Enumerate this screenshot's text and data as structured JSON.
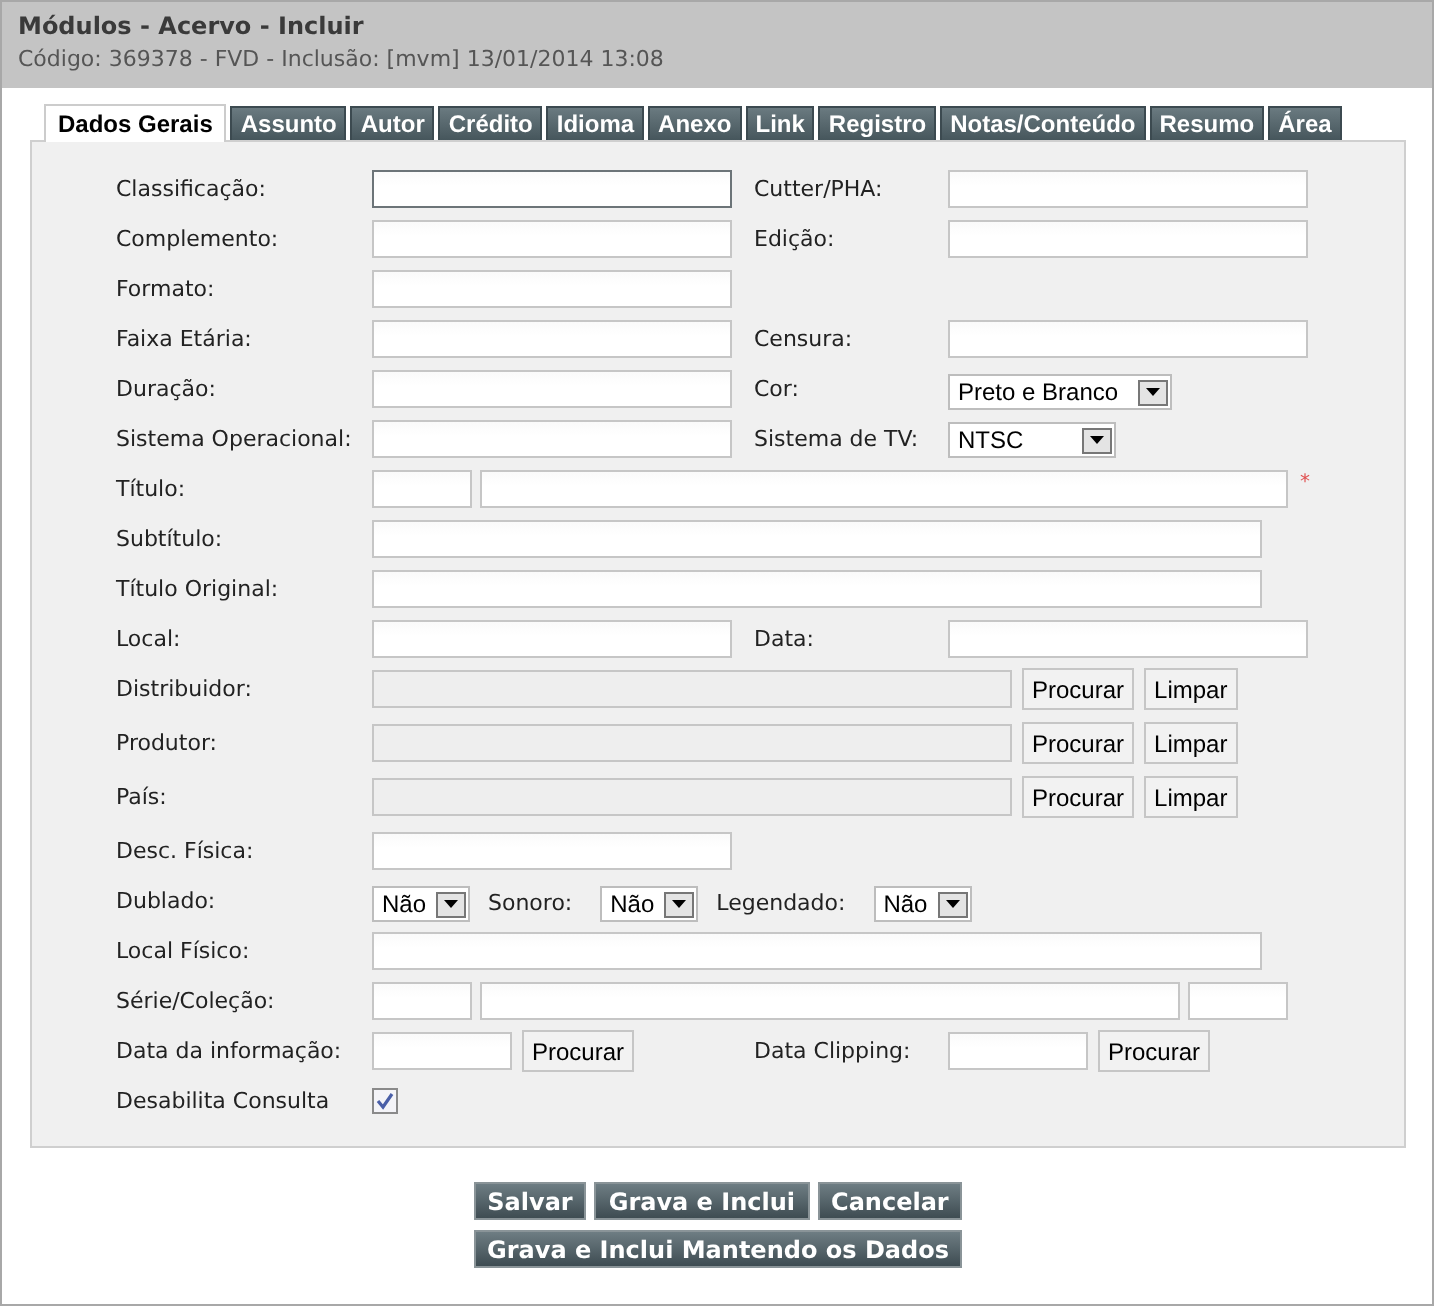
{
  "header": {
    "title": "Módulos - Acervo - Incluir",
    "subtitle": "Código: 369378 - FVD - Inclusão: [mvm] 13/01/2014 13:08"
  },
  "tabs": [
    {
      "label": "Dados Gerais",
      "selected": true
    },
    {
      "label": "Assunto",
      "selected": false
    },
    {
      "label": "Autor",
      "selected": false
    },
    {
      "label": "Crédito",
      "selected": false
    },
    {
      "label": "Idioma",
      "selected": false
    },
    {
      "label": "Anexo",
      "selected": false
    },
    {
      "label": "Link",
      "selected": false
    },
    {
      "label": "Registro",
      "selected": false
    },
    {
      "label": "Notas/Conteúdo",
      "selected": false
    },
    {
      "label": "Resumo",
      "selected": false
    },
    {
      "label": "Área",
      "selected": false
    }
  ],
  "rows": [
    {
      "kind": "pair",
      "fields": [
        {
          "label": "Classificação:",
          "kind": "text",
          "focused": true
        },
        {
          "label": "Cutter/PHA:",
          "kind": "text",
          "focused": false
        }
      ]
    },
    {
      "kind": "pair",
      "fields": [
        {
          "label": "Complemento:",
          "kind": "text",
          "focused": false
        },
        {
          "label": "Edição:",
          "kind": "text",
          "focused": false
        }
      ]
    },
    {
      "kind": "pair",
      "fields": [
        {
          "label": "Formato:",
          "kind": "text",
          "focused": false
        }
      ]
    },
    {
      "kind": "pair",
      "fields": [
        {
          "label": "Faixa Etária:",
          "kind": "text",
          "focused": false
        },
        {
          "label": "Censura:",
          "kind": "text",
          "focused": false
        }
      ]
    },
    {
      "kind": "pair",
      "fields": [
        {
          "label": "Duração:",
          "kind": "text",
          "focused": false
        },
        {
          "label": "Cor:",
          "kind": "select",
          "value": "Preto e Branco"
        }
      ]
    },
    {
      "kind": "pair",
      "fields": [
        {
          "label": "Sistema Operacional:",
          "kind": "text",
          "focused": false
        },
        {
          "label": "Sistema de TV:",
          "kind": "select",
          "value": "NTSC"
        }
      ]
    },
    {
      "kind": "split2",
      "label": "Título:",
      "required_mark": "*"
    },
    {
      "kind": "wide",
      "label": "Subtítulo:"
    },
    {
      "kind": "wide",
      "label": "Título Original:"
    },
    {
      "kind": "pair",
      "fields": [
        {
          "label": "Local:",
          "kind": "text",
          "focused": false
        },
        {
          "label": "Data:",
          "kind": "text",
          "focused": false
        }
      ]
    },
    {
      "kind": "lookup",
      "label": "Distribuidor:",
      "disabled": true,
      "buttons": [
        "Procurar",
        "Limpar"
      ]
    },
    {
      "kind": "lookup",
      "label": "Produtor:",
      "disabled": true,
      "buttons": [
        "Procurar",
        "Limpar"
      ]
    },
    {
      "kind": "lookup",
      "label": "País:",
      "disabled": true,
      "buttons": [
        "Procurar",
        "Limpar"
      ]
    },
    {
      "kind": "pair",
      "fields": [
        {
          "label": "Desc. Física:",
          "kind": "text",
          "focused": false
        }
      ]
    },
    {
      "kind": "selects",
      "items": [
        {
          "label": "Dublado:",
          "value": "Não"
        },
        {
          "label": "Sonoro:",
          "value": "Não"
        },
        {
          "label": "Legendado:",
          "value": "Não"
        }
      ]
    },
    {
      "kind": "wide",
      "label": "Local Físico:"
    },
    {
      "kind": "split3",
      "label": "Série/Coleção:"
    },
    {
      "kind": "dates",
      "fields": [
        {
          "label": "Data da informação:",
          "button": "Procurar"
        },
        {
          "label": "Data Clipping:",
          "button": "Procurar"
        }
      ]
    },
    {
      "kind": "checkbox",
      "label": "Desabilita Consulta",
      "checked": true
    }
  ],
  "actions": [
    [
      "Salvar",
      "Grava e Inclui",
      "Cancelar"
    ],
    [
      "Grava e Inclui Mantendo os Dados"
    ]
  ]
}
